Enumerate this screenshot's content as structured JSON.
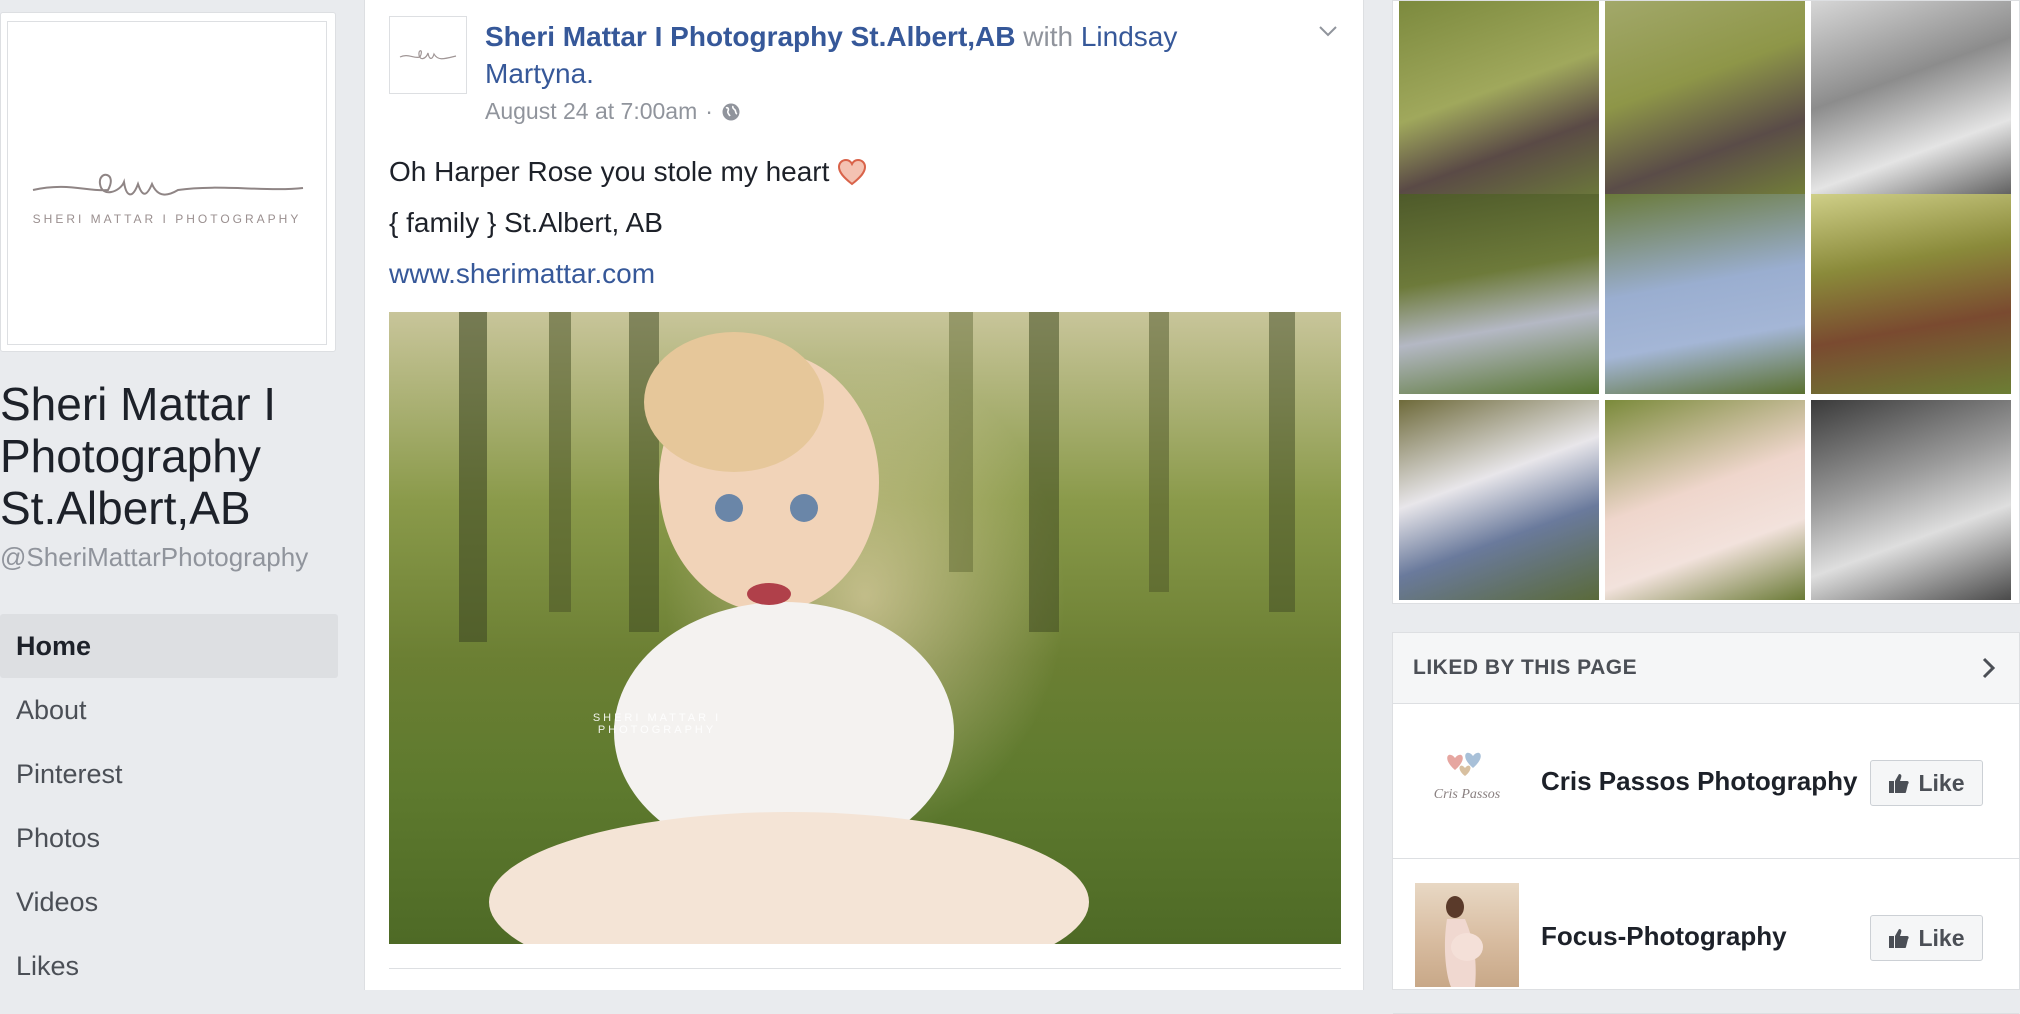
{
  "page": {
    "name": "Sheri Mattar I Photography St.Albert,AB",
    "name_lines": [
      "Sheri Mattar I",
      "Photography",
      "St.Albert,AB"
    ],
    "handle": "@SheriMattarPhotography",
    "logo_caption": "SHERI MATTAR I PHOTOGRAPHY"
  },
  "nav": {
    "items": [
      {
        "label": "Home",
        "active": true
      },
      {
        "label": "About"
      },
      {
        "label": "Pinterest"
      },
      {
        "label": "Photos"
      },
      {
        "label": "Videos"
      },
      {
        "label": "Likes"
      }
    ]
  },
  "post": {
    "author": "Sheri Mattar I Photography St.Albert,AB",
    "with_word": "with",
    "tagged": "Lindsay Martyna.",
    "timestamp": "August 24 at 7:00am",
    "separator": "·",
    "lines": [
      "Oh Harper Rose you stole my heart",
      "{ family } St.Albert, AB"
    ],
    "link": "www.sherimattar.com",
    "watermark": "SHERI MATTAR I PHOTOGRAPHY",
    "icons": {
      "visibility": "globe-icon",
      "menu": "chevron-down-icon",
      "emoji": "heart-icon"
    }
  },
  "sidebar": {
    "liked_title": "LIKED BY THIS PAGE",
    "liked": [
      {
        "name": "Cris Passos Photography",
        "like_label": "Like",
        "thumb_text": "Cris Passos"
      },
      {
        "name": "Focus-Photography",
        "like_label": "Like"
      }
    ]
  },
  "colors": {
    "link": "#365899",
    "background": "#e9ebee",
    "heart": "#e2826a"
  }
}
